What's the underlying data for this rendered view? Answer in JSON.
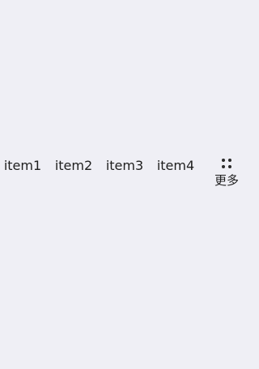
{
  "toolbar": {
    "items": [
      {
        "label": "item1"
      },
      {
        "label": "item2"
      },
      {
        "label": "item3"
      },
      {
        "label": "item4"
      }
    ],
    "more": {
      "label": "更多",
      "icon": "more-dots-icon"
    }
  },
  "colors": {
    "background": "#EFEFF5",
    "text": "#1F1F1F"
  }
}
